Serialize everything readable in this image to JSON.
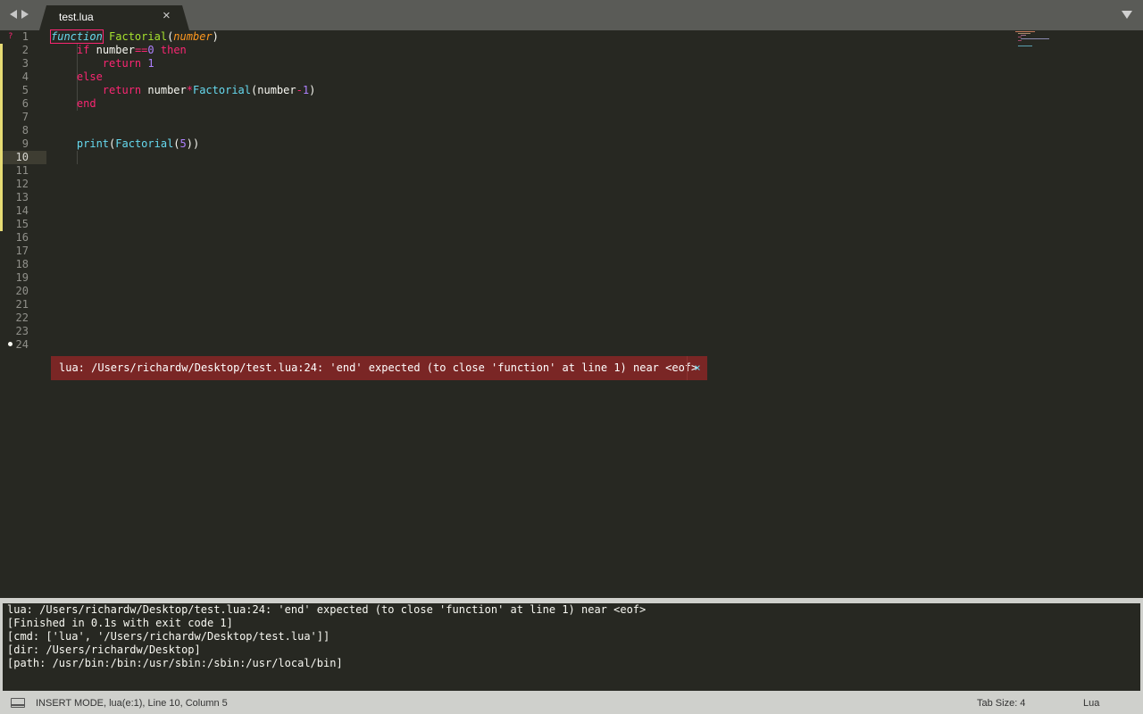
{
  "tabs": [
    {
      "label": "test.lua",
      "active": true
    }
  ],
  "editor": {
    "line_numbers": [
      "1",
      "2",
      "3",
      "4",
      "5",
      "6",
      "7",
      "8",
      "9",
      "10",
      "11",
      "12",
      "13",
      "14",
      "15",
      "16",
      "17",
      "18",
      "19",
      "20",
      "21",
      "22",
      "23",
      "24"
    ],
    "active_line": "10",
    "error_marker": "?",
    "code": {
      "l1": {
        "kw": "function",
        "name": "Factorial",
        "open": "(",
        "param": "number",
        "close": ")"
      },
      "l2": {
        "kw_if": "if",
        "var": "number",
        "op": "==",
        "num": "0",
        "kw_then": "then"
      },
      "l3": {
        "kw": "return",
        "num": "1"
      },
      "l4": {
        "kw": "else"
      },
      "l5": {
        "kw": "return",
        "var": "number",
        "op": "*",
        "fn": "Factorial",
        "open": "(",
        "arg": "number",
        "minus": "-",
        "num": "1",
        "close": ")"
      },
      "l6": {
        "kw": "end"
      },
      "l9": {
        "fn": "print",
        "open": "(",
        "fn2": "Factorial",
        "open2": "(",
        "num": "5",
        "close": "))"
      }
    }
  },
  "inline_error": {
    "text": "lua: /Users/richardw/Desktop/test.lua:24: 'end' expected (to close 'function' at line 1) near <eof>",
    "close": "×"
  },
  "output": {
    "lines": [
      "lua: /Users/richardw/Desktop/test.lua:24: 'end' expected (to close 'function' at line 1) near <eof>",
      "[Finished in 0.1s with exit code 1]",
      "[cmd: ['lua', '/Users/richardw/Desktop/test.lua']]",
      "[dir: /Users/richardw/Desktop]",
      "[path: /usr/bin:/bin:/usr/sbin:/sbin:/usr/local/bin]"
    ]
  },
  "statusbar": {
    "status": "INSERT MODE, lua(e:1), Line 10, Column 5",
    "tab_size": "Tab Size: 4",
    "syntax": "Lua"
  },
  "tab_close": "×",
  "colors": {
    "background": "#272822",
    "keyword": "#f92672",
    "function": "#a6e22e",
    "support": "#66d9ef",
    "number": "#ae81ff",
    "parameter": "#fd971f",
    "error_bg": "#7a2625",
    "modified_marker": "#e6db74"
  },
  "icons": [
    "back-arrow-icon",
    "forward-arrow-icon",
    "close-icon",
    "dropdown-icon",
    "toggle-panel-icon"
  ]
}
